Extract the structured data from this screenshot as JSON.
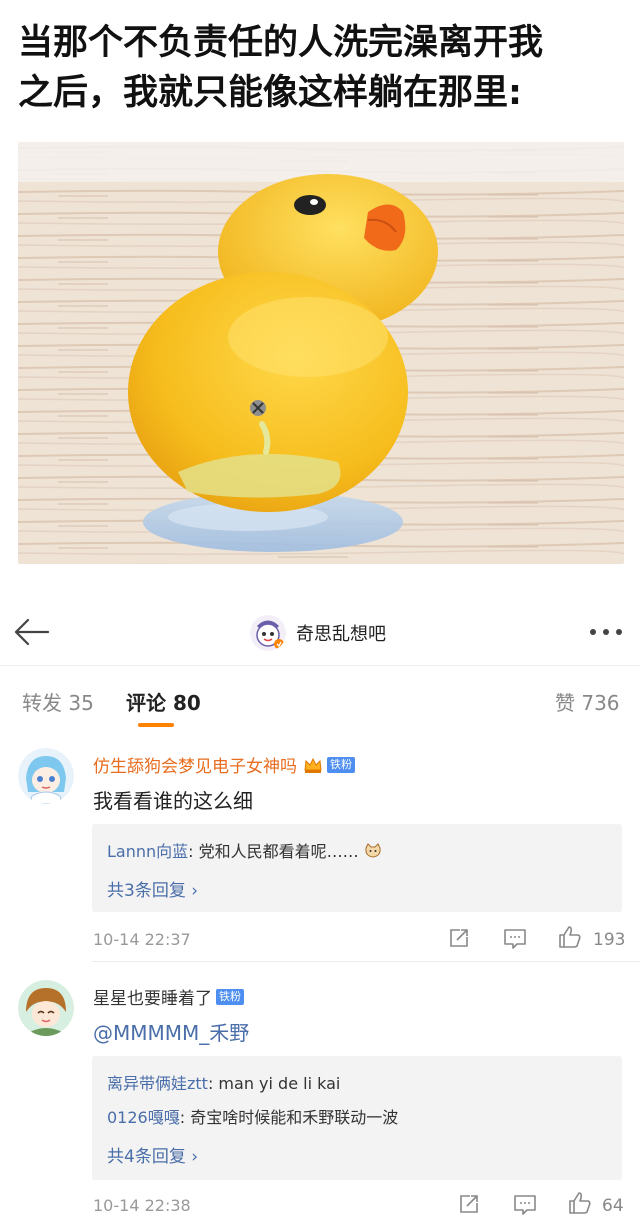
{
  "caption": {
    "line1": "当那个不负责任的人洗完澡离开我",
    "line2": "之后，我就只能像这样躺在那里:"
  },
  "topbar": {
    "channel_name": "奇思乱想吧",
    "icons": [
      "back-arrow-icon",
      "more-dots-icon"
    ]
  },
  "tabs": {
    "repost": "转发 35",
    "comments": "评论 80",
    "likes": "赞 736"
  },
  "colors": {
    "accent": "#ff8200",
    "link": "#4a6ea9",
    "username_orange": "#e86d1f",
    "badge_blue": "#4d8ef0"
  },
  "comments": [
    {
      "username": "仿生舔狗会梦见电子女神吗",
      "badge": "铁粉",
      "text": "我看看谁的这么细",
      "replies": [
        {
          "author": "Lannn向蓝",
          "text": ": 党和人民都看着呢……"
        }
      ],
      "more_replies": "共3条回复 ›",
      "time": "10-14 22:37",
      "likes": "193"
    },
    {
      "username": "星星也要睡着了",
      "badge": "铁粉",
      "text": "@MMMMM_禾野",
      "replies": [
        {
          "author": "离异带俩娃ztt",
          "text": ": man yi de li kai"
        },
        {
          "author": "0126嘎嘎",
          "text": ": 奇宝啥时候能和禾野联动一波"
        }
      ],
      "more_replies": "共4条回复 ›",
      "time": "10-14 22:38",
      "likes": "64"
    }
  ]
}
